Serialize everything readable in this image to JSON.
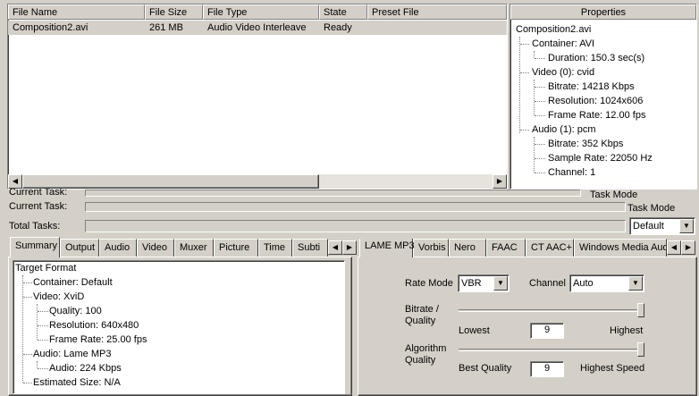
{
  "file_list": {
    "columns": [
      "File Name",
      "File Size",
      "File Type",
      "State",
      "Preset File"
    ],
    "rows": [
      {
        "name": "Composition2.avi",
        "size": "261 MB",
        "type": "Audio Video Interleave",
        "state": "Ready",
        "preset": ""
      }
    ]
  },
  "properties": {
    "header": "Properties",
    "root": "Composition2.avi",
    "container": "Container: AVI",
    "duration": "Duration: 150.3 sec(s)",
    "video": "Video (0): cvid",
    "video_bitrate": "Bitrate: 14218 Kbps",
    "video_resolution": "Resolution: 1024x606",
    "video_framerate": "Frame Rate: 12.00 fps",
    "audio": "Audio (1): pcm",
    "audio_bitrate": "Bitrate: 352 Kbps",
    "audio_samplerate": "Sample Rate: 22050 Hz",
    "audio_channel": "Channel: 1"
  },
  "progress": {
    "current_task_partial": "Current Task:",
    "current_task": "Current Task:",
    "total_tasks": "Total Tasks:",
    "task_mode_partial": "Task Mode",
    "task_mode": "Task Mode",
    "task_mode_select": "Default"
  },
  "left_tabs": [
    "Summary",
    "Output",
    "Audio",
    "Video",
    "Muxer",
    "Picture",
    "Time",
    "Subti"
  ],
  "summary": {
    "root": "Target Format",
    "container": "Container: Default",
    "video": "Video: XviD",
    "quality": "Quality: 100",
    "resolution": "Resolution: 640x480",
    "framerate": "Frame Rate: 25.00 fps",
    "audio": "Audio: Lame MP3",
    "audio_bitrate": "Audio: 224 Kbps",
    "estimated": "Estimated Size: N/A"
  },
  "right_tabs": [
    "LAME MP3",
    "Vorbis",
    "Nero",
    "FAAC",
    "CT AAC+",
    "Windows Media Aud"
  ],
  "lame": {
    "rate_mode_label": "Rate Mode",
    "rate_mode_value": "VBR",
    "channel_label": "Channel",
    "channel_value": "Auto",
    "bitrate_quality_label": "Bitrate / Quality",
    "lowest_label": "Lowest",
    "bitrate_value": "9",
    "highest_label": "Highest",
    "algorithm_label": "Algorithm Quality",
    "best_quality_label": "Best Quality",
    "algorithm_value": "9",
    "highest_speed_label": "Highest Speed",
    "bitrate_slider_level": 1.0,
    "algorithm_slider_level": 1.0
  }
}
